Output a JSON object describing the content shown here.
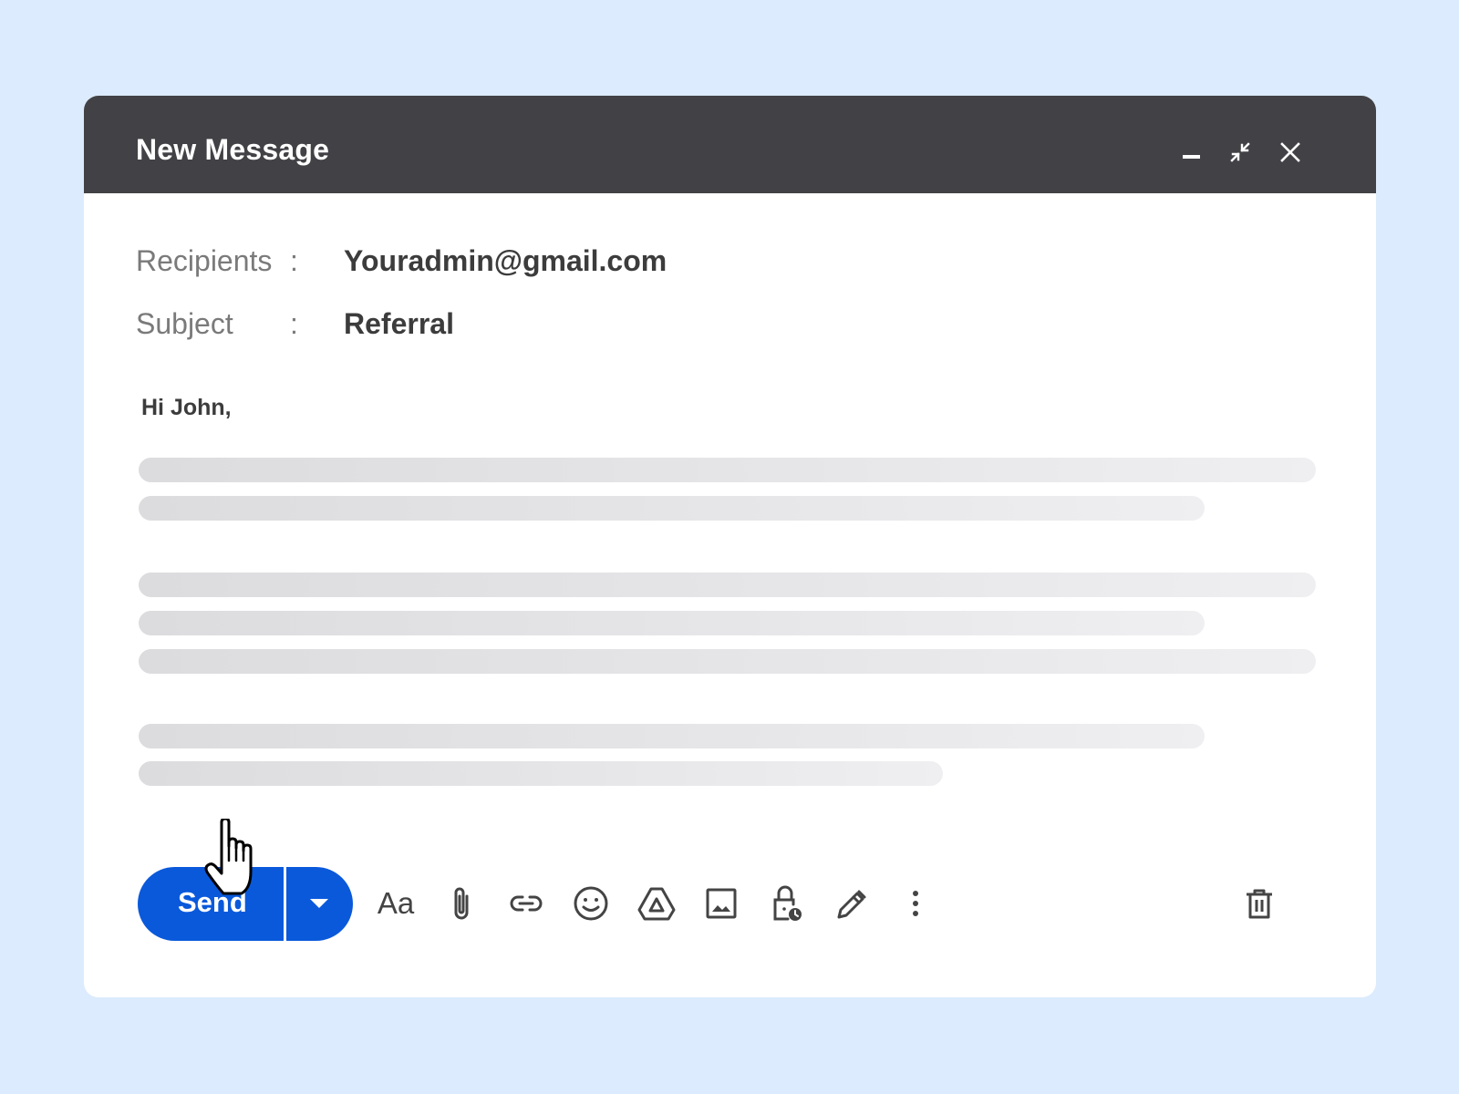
{
  "window": {
    "title": "New Message",
    "controls": [
      "minimize-icon",
      "exit-fullscreen-icon",
      "close-icon"
    ]
  },
  "fields": {
    "recipients": {
      "label": "Recipients",
      "colon": ":",
      "value": "Youradmin@gmail.com"
    },
    "subject": {
      "label": "Subject",
      "colon": ":",
      "value": "Referral"
    }
  },
  "body": {
    "greeting": "Hi John,",
    "placeholder_line_count": 7
  },
  "toolbar": {
    "send_label": "Send",
    "format_label": "Aa",
    "tools": [
      "formatting-options-icon",
      "attach-file-icon",
      "insert-link-icon",
      "insert-emoji-icon",
      "google-drive-icon",
      "insert-photo-icon",
      "confidential-mode-icon",
      "insert-signature-icon",
      "more-options-icon",
      "discard-draft-icon"
    ]
  },
  "colors": {
    "page_background": "#dcebfd",
    "titlebar": "#424145",
    "send_button": "#0a59db",
    "icon": "#444444"
  }
}
